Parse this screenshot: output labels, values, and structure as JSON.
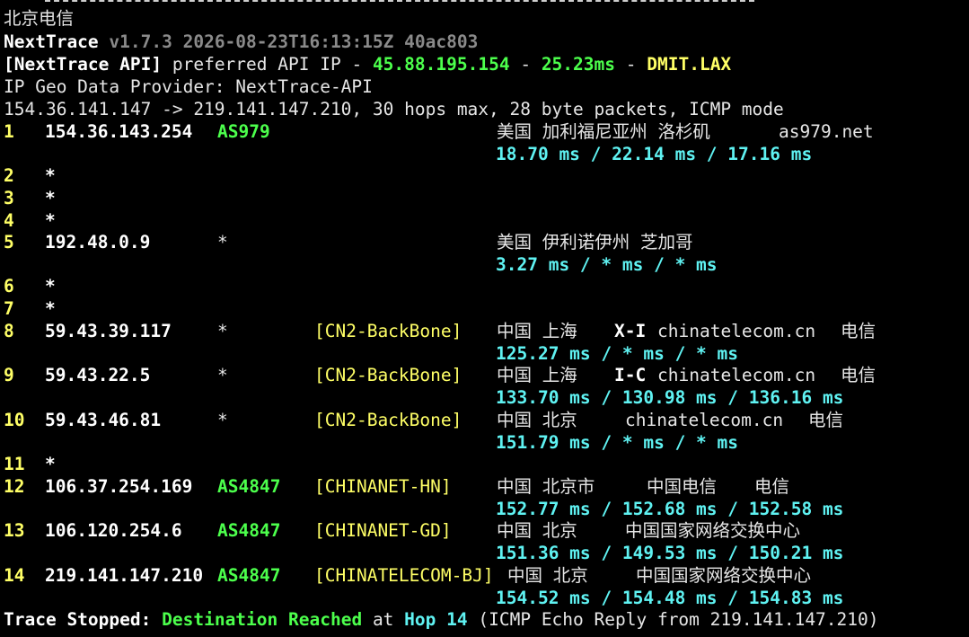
{
  "header": {
    "location": "北京电信",
    "app_name": "NextTrace",
    "version": "v1.7.3 2026-08-23T16:13:15Z 40ac803",
    "api_label": "[NextTrace API]",
    "api_text": "preferred API IP -",
    "api_ip": "45.88.195.154",
    "api_sep1": "-",
    "api_latency": "25.23ms",
    "api_sep2": "-",
    "api_node": "DMIT.LAX",
    "geo_provider": "IP Geo Data Provider: NextTrace-API",
    "trace_info": "154.36.141.147 -> 219.141.147.210, 30 hops max, 28 byte packets, ICMP mode"
  },
  "hops": [
    {
      "num": "1",
      "ip": "154.36.143.254",
      "asn": "AS979",
      "geo": "美国 加利福尼亚州 洛杉矶",
      "host": "as979.net",
      "rtt": "18.70 ms / 22.14 ms / 17.16 ms"
    },
    {
      "num": "2",
      "ip": "*"
    },
    {
      "num": "3",
      "ip": "*"
    },
    {
      "num": "4",
      "ip": "*"
    },
    {
      "num": "5",
      "ip": "192.48.0.9",
      "asn": "*",
      "geo": "美国 伊利诺伊州 芝加哥",
      "rtt": "3.27 ms / * ms / * ms"
    },
    {
      "num": "6",
      "ip": "*"
    },
    {
      "num": "7",
      "ip": "*"
    },
    {
      "num": "8",
      "ip": "59.43.39.117",
      "asn": "*",
      "tag": "[CN2-BackBone]",
      "geo": "中国 上海",
      "code": "X-I",
      "host": "chinatelecom.cn",
      "isp": "电信",
      "rtt": "125.27 ms / * ms / * ms"
    },
    {
      "num": "9",
      "ip": "59.43.22.5",
      "asn": "*",
      "tag": "[CN2-BackBone]",
      "geo": "中国 上海",
      "code": "I-C",
      "host": "chinatelecom.cn",
      "isp": "电信",
      "rtt": "133.70 ms / 130.98 ms / 136.16 ms"
    },
    {
      "num": "10",
      "ip": "59.43.46.81",
      "asn": "*",
      "tag": "[CN2-BackBone]",
      "geo": "中国 北京",
      "host": "chinatelecom.cn",
      "isp": "电信",
      "rtt": "151.79 ms / * ms / * ms"
    },
    {
      "num": "11",
      "ip": "*"
    },
    {
      "num": "12",
      "ip": "106.37.254.169",
      "asn": "AS4847",
      "tag": "[CHINANET-HN]",
      "geo": "中国 北京市",
      "host": "中国电信",
      "isp": "电信",
      "rtt": "152.77 ms / 152.68 ms / 152.58 ms"
    },
    {
      "num": "13",
      "ip": "106.120.254.6",
      "asn": "AS4847",
      "tag": "[CHINANET-GD]",
      "geo": "中国 北京",
      "host": "中国国家网络交换中心",
      "rtt": "151.36 ms / 149.53 ms / 150.21 ms"
    },
    {
      "num": "14",
      "ip": "219.141.147.210",
      "asn": "AS4847",
      "tag": "[CHINATELECOM-BJ]",
      "geo": "中国 北京",
      "host": "中国国家网络交换中心",
      "rtt": "154.52 ms / 154.48 ms / 154.83 ms"
    }
  ],
  "footer": {
    "label": "Trace Stopped:",
    "status": "Destination Reached",
    "at": "at",
    "hop": "Hop 14",
    "detail": "(ICMP Echo Reply from 219.141.147.210)"
  },
  "colors": {
    "background": "#000000",
    "hop_number": "#ffff66",
    "asn": "#4cff4c",
    "rtt": "#5ff2f2",
    "tag": "#ffff66",
    "version": "#8a8a8a"
  }
}
